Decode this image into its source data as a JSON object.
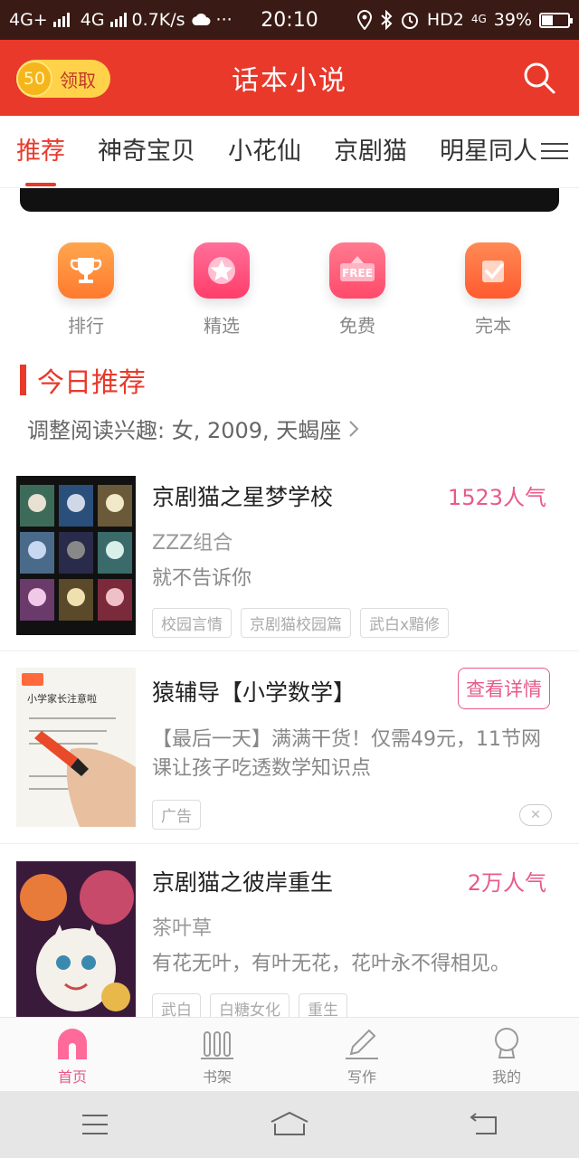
{
  "status_bar": {
    "network_left": "4G+",
    "network_right": "4G",
    "speed": "0.7K/s",
    "more": "···",
    "time": "20:10",
    "hd": "HD2",
    "net_badge": "4G",
    "battery": "39%",
    "battery_level": 0.39
  },
  "header": {
    "coin_value": "50",
    "coin_label": "领取",
    "title": "话本小说",
    "icon": "search-icon"
  },
  "tabs": [
    {
      "label": "推荐"
    },
    {
      "label": "神奇宝贝"
    },
    {
      "label": "小花仙"
    },
    {
      "label": "京剧猫"
    },
    {
      "label": "明星同人"
    }
  ],
  "quick_entries": [
    {
      "label": "排行",
      "icon": "trophy-icon",
      "color": "#ff8a3d"
    },
    {
      "label": "精选",
      "icon": "star-icon",
      "color": "#ff4f7a"
    },
    {
      "label": "免费",
      "icon": "free-icon",
      "color": "#ff5a76",
      "badge": "FREE"
    },
    {
      "label": "完本",
      "icon": "check-icon",
      "color": "#ff6a3d"
    }
  ],
  "section": {
    "title": "今日推荐",
    "interest": "调整阅读兴趣: 女, 2009, 天蝎座"
  },
  "books": [
    {
      "title": "京剧猫之星梦学校",
      "popularity": "1523人气",
      "author": "ZZZ组合",
      "desc": "就不告诉你",
      "tags": [
        "校园言情",
        "京剧猫校园篇",
        "武白x黯修"
      ]
    },
    {
      "title": "京剧猫之彼岸重生",
      "popularity": "2万人气",
      "author": "茶叶草",
      "desc": "有花无叶，有叶无花，花叶永不得相见。",
      "tags": [
        "武白",
        "白糖女化",
        "重生"
      ]
    }
  ],
  "ad": {
    "title": "猿辅导【小学数学】",
    "button": "查看详情",
    "desc": "【最后一天】满满干货！仅需49元，11节网课让孩子吃透数学知识点",
    "tag": "广告",
    "cover_caption": "小学家长注意啦"
  },
  "bottom_nav": [
    {
      "label": "首页",
      "icon": "home-icon",
      "active": true
    },
    {
      "label": "书架",
      "icon": "bookshelf-icon",
      "active": false
    },
    {
      "label": "写作",
      "icon": "pencil-icon",
      "active": false
    },
    {
      "label": "我的",
      "icon": "profile-icon",
      "active": false
    }
  ],
  "colors": {
    "accent": "#e8392b",
    "pink": "#e85a8a"
  }
}
